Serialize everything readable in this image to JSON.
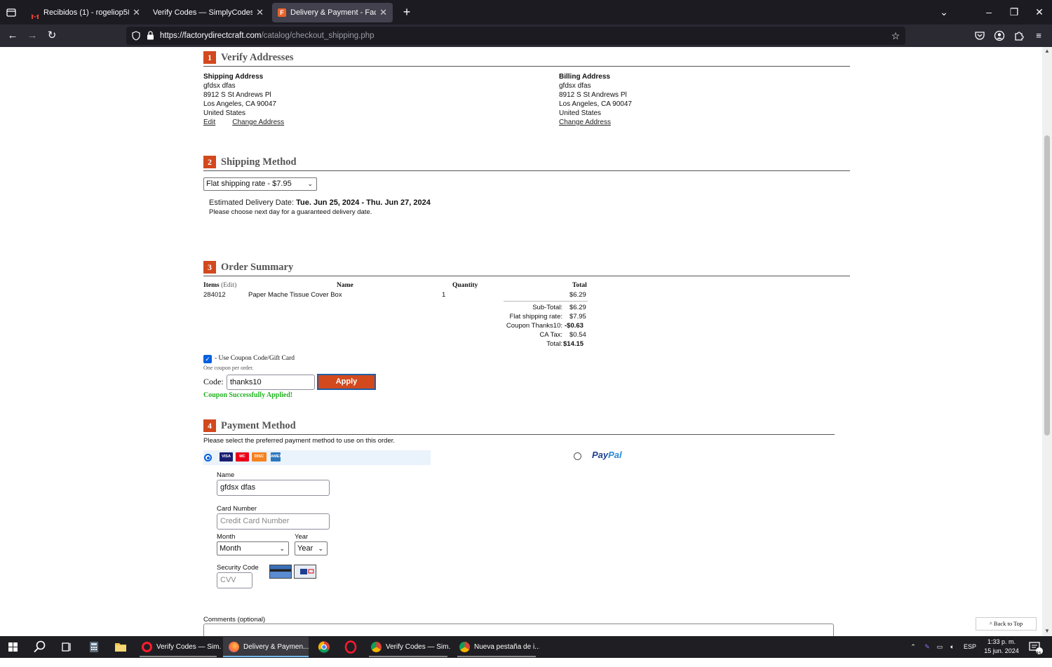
{
  "browser": {
    "tabs": [
      {
        "label": "Recibidos (1) - rogeliop58510@",
        "favicon": "gmail-icon"
      },
      {
        "label": "Verify Codes — SimplyCodes",
        "favicon": "none"
      },
      {
        "label": "Delivery & Payment - Factory D",
        "favicon": "factory-icon"
      }
    ],
    "new_tab": "+",
    "url_host": "https://factorydirectcraft.com",
    "url_path": "/catalog/checkout_shipping.php"
  },
  "sections": {
    "s1": {
      "num": "1",
      "title": "Verify Addresses"
    },
    "s2": {
      "num": "2",
      "title": "Shipping Method"
    },
    "s3": {
      "num": "3",
      "title": "Order Summary"
    },
    "s4": {
      "num": "4",
      "title": "Payment Method"
    }
  },
  "shipping_address": {
    "heading": "Shipping Address",
    "name": "gfdsx dfas",
    "street": "8912 S St Andrews Pl",
    "city": "Los Angeles, CA 90047",
    "country": "United States",
    "edit": "Edit",
    "change": "Change Address"
  },
  "billing_address": {
    "heading": "Billing Address",
    "name": "gfdsx dfas",
    "street": "8912 S St Andrews Pl",
    "city": "Los Angeles, CA 90047",
    "country": "United States",
    "change": "Change Address"
  },
  "shipping": {
    "selected": "Flat shipping rate - $7.95",
    "est_label": "Estimated Delivery Date:",
    "est_value": "Tue. Jun 25, 2024 - Thu. Jun 27, 2024",
    "note": "Please choose next day for a guaranteed delivery date."
  },
  "order": {
    "headers": {
      "items": "Items",
      "edit": "(Edit)",
      "name": "Name",
      "quantity": "Quantity",
      "total": "Total"
    },
    "item": {
      "sku": "284012",
      "name": "Paper Mache Tissue Cover Box",
      "qty": "1",
      "total": "$6.29"
    },
    "totals": [
      {
        "label": "Sub-Total:",
        "value": "$6.29"
      },
      {
        "label": "Flat shipping rate:",
        "value": "$7.95"
      },
      {
        "label": "Coupon Thanks10:",
        "value": "-$0.63"
      },
      {
        "label": "CA Tax:",
        "value": "$0.54"
      },
      {
        "label": "Total:",
        "value": "$14.15"
      }
    ]
  },
  "coupon": {
    "checkbox_label": "- Use Coupon Code/Gift Card",
    "note": "One coupon per order.",
    "code_label": "Code:",
    "code_value": "thanks10",
    "apply": "Apply",
    "success": "Coupon Successfully Applied!"
  },
  "payment": {
    "note": "Please select the preferred payment method to use on this order.",
    "cards": [
      "VISA",
      "MC",
      "DISC",
      "AMEX"
    ],
    "paypal_a": "Pay",
    "paypal_b": "Pal",
    "name_label": "Name",
    "name_value": "gfdsx dfas",
    "card_label": "Card Number",
    "card_placeholder": "Credit Card Number",
    "month_label": "Month",
    "month_value": "Month",
    "year_label": "Year",
    "year_value": "Year",
    "cvv_label": "Security Code",
    "cvv_placeholder": "CVV"
  },
  "comments_label": "Comments (optional)",
  "back_to_top": "^ Back to Top",
  "taskbar": {
    "apps": [
      {
        "label": "Verify Codes — Sim...",
        "icon": "opera-icon"
      },
      {
        "label": "Delivery & Paymen...",
        "icon": "firefox-icon"
      },
      {
        "label": "Verify Codes — Sim...",
        "icon": "chrome-icon"
      },
      {
        "label": "Nueva pestaña de i...",
        "icon": "chrome-icon"
      }
    ],
    "lang": "ESP",
    "time": "1:33 p. m.",
    "date": "15 jun. 2024",
    "notif_count": "21"
  },
  "colors": {
    "accent": "#d2491e",
    "success": "#22b222",
    "link_blue": "#0060df"
  }
}
